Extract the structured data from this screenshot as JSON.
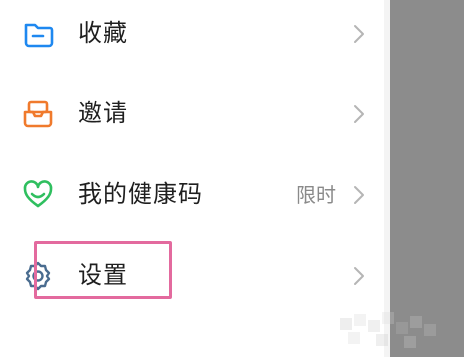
{
  "menu": {
    "items": [
      {
        "label": "收藏",
        "icon": "folder-icon",
        "icon_color": "#1e88f0",
        "badge": ""
      },
      {
        "label": "邀请",
        "icon": "inbox-icon",
        "icon_color": "#f07a2c",
        "badge": ""
      },
      {
        "label": "我的健康码",
        "icon": "heart-icon",
        "icon_color": "#2fbf5f",
        "badge": "限时"
      },
      {
        "label": "设置",
        "icon": "gear-icon",
        "icon_color": "#4a6c8f",
        "badge": ""
      }
    ]
  },
  "colors": {
    "highlight": "#e36a9e",
    "overlay": "#8c8c8c"
  }
}
